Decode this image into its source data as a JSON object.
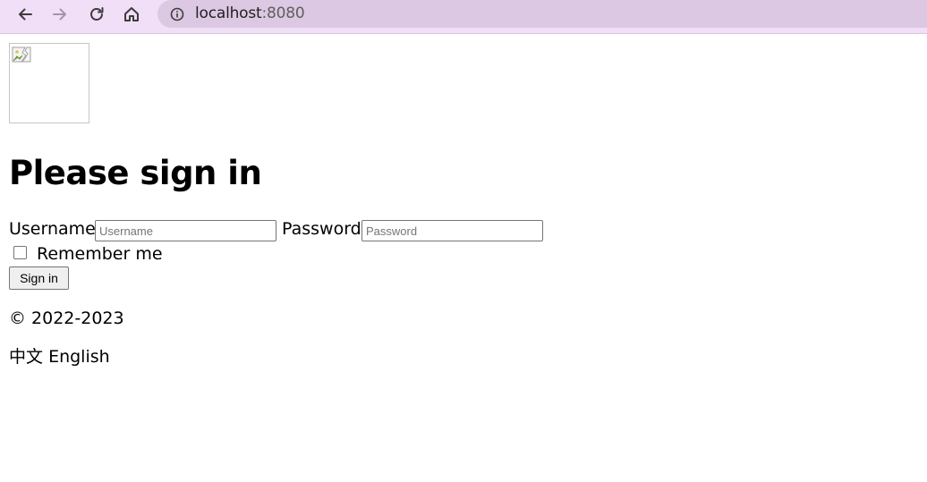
{
  "browser": {
    "url_host": "localhost",
    "url_port": ":8080"
  },
  "page": {
    "logo_alt": "",
    "heading": "Please sign in",
    "username_label": "Username",
    "username_placeholder": "Username",
    "password_label": "Password",
    "password_placeholder": "Password",
    "remember_label": "Remember me",
    "remember_checked": false,
    "sign_in_label": "Sign in",
    "copyright": "© 2022-2023",
    "languages": [
      "中文",
      "English"
    ]
  },
  "colors": {
    "toolbar_bg": "#f1def7",
    "omnibox_bg": "#dcc8e2"
  }
}
